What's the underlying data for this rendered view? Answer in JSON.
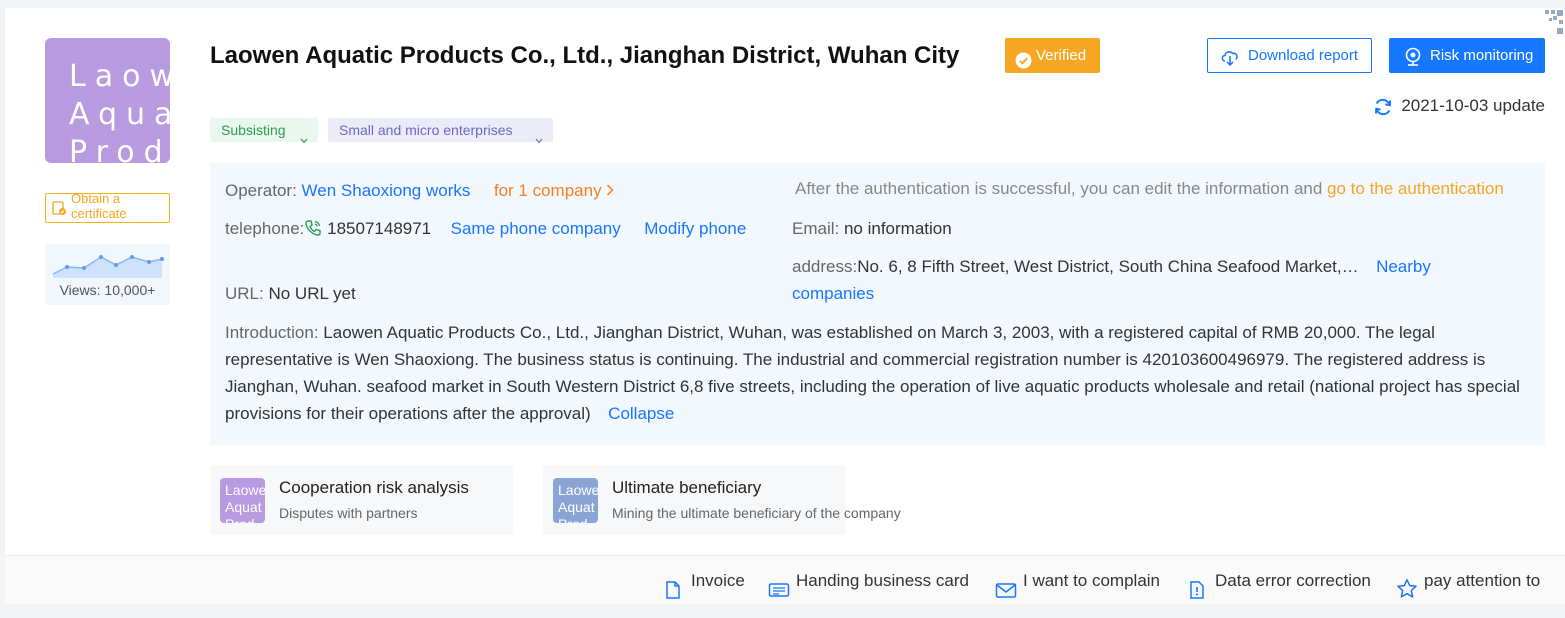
{
  "company": {
    "logo_text": "Laow\nAqua\nProd",
    "name": "Laowen Aquatic Products Co., Ltd., Jianghan District, Wuhan City",
    "verified_label": "Verified",
    "status_tag": "Subsisting",
    "size_tag": "Small and micro enterprises"
  },
  "left": {
    "certificate_label": "Obtain a certificate",
    "views_label": "Views: 10,000+"
  },
  "actions": {
    "download_label": "Download report",
    "risk_label": "Risk monitoring",
    "update_label": "2021-10-03 update"
  },
  "info": {
    "operator_label": "Operator:",
    "operator_value": "Wen Shaoxiong works",
    "operator_companies": "for 1 company",
    "auth_text": "After the authentication is successful, you can edit the information and",
    "auth_link": "go to the authentication",
    "telephone_label": "telephone:",
    "telephone_value": "18507148971",
    "same_phone_link": "Same phone company",
    "modify_phone_link": "Modify phone",
    "email_label": "Email:",
    "email_value": "no information",
    "url_label": "URL:",
    "url_value": "No URL yet",
    "address_label": "address:",
    "address_value": "No. 6, 8 Fifth Street, West District, South China Seafood Market,…",
    "nearby_link_1": "Nearby",
    "nearby_link_2": "companies",
    "intro_label": "Introduction:",
    "intro_text": "Laowen Aquatic Products Co., Ltd., Jianghan District, Wuhan, was established on March 3, 2003, with a registered capital of RMB 20,000. The legal representative is Wen Shaoxiong. The business status is continuing. The industrial and commercial registration number is 420103600496979. The registered address is Jianghan, Wuhan. seafood market in South Western District 6,8 five streets, including the operation of live aquatic products wholesale and retail (national project has special provisions for their operations after the approval)",
    "collapse_link": "Collapse"
  },
  "features": [
    {
      "thumb_text": "Laowe\nAquat\nProd",
      "title": "Cooperation risk analysis",
      "subtitle": "Disputes with partners"
    },
    {
      "thumb_text": "Laowe\nAquat\nProd",
      "title": "Ultimate beneficiary",
      "subtitle": "Mining the ultimate beneficiary of the company"
    }
  ],
  "footer": {
    "invoice": "Invoice",
    "business_card": "Handing business card",
    "complain": "I want to complain",
    "correction": "Data error correction",
    "attention": "pay attention to"
  },
  "colors": {
    "primary": "#1677ff",
    "verified": "#f5a623",
    "logo": "#b89ae0",
    "status_green": "#2a9d4b",
    "panel_bg": "#f2f8fe"
  }
}
